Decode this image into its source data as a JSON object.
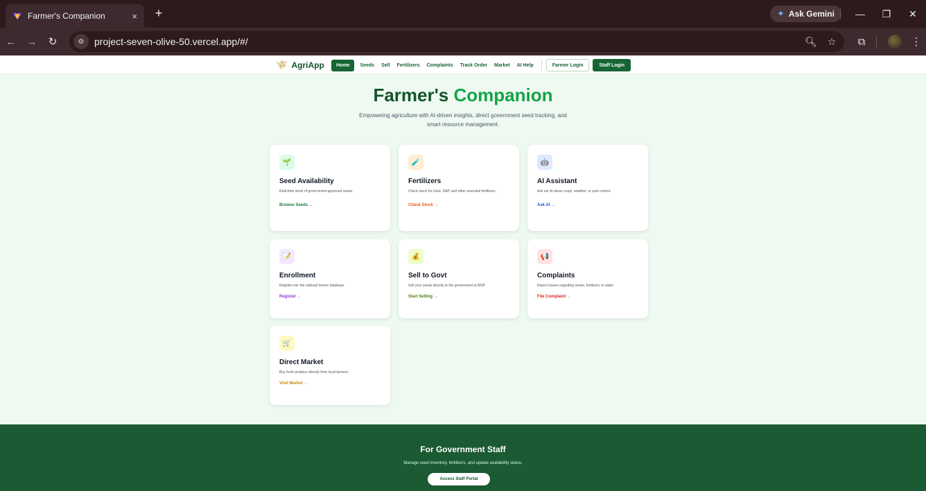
{
  "browser": {
    "tab_title": "Farmer's Companion",
    "tab_close": "×",
    "new_tab": "+",
    "gemini_label": "Ask Gemini",
    "url": "project-seven-olive-50.vercel.app/#/",
    "icons": {
      "favicon": "purple-heart-favicon-icon",
      "back": "arrow-left-icon",
      "forward": "arrow-right-icon",
      "reload": "reload-icon",
      "site_info": "tune-icon",
      "zoom": "zoom-icon",
      "bookmark": "star-icon",
      "extensions": "puzzle-icon",
      "menu": "kebab-icon"
    }
  },
  "nav": {
    "brand": "AgriApp",
    "links": [
      "Home",
      "Seeds",
      "Sell",
      "Fertilizers",
      "Complaints",
      "Track Order",
      "Market",
      "AI Help"
    ],
    "active_link": "Home",
    "farmer_login": "Farmer Login",
    "staff_login": "Staff Login"
  },
  "hero": {
    "title_part1": "Farmer's",
    "title_part2": "Companion",
    "subtitle": "Empowering agriculture with AI-driven insights, direct government seed tracking, and smart resource management."
  },
  "cards": [
    {
      "title": "Seed Availability",
      "desc": "Real-time stock of government-approved seeds.",
      "link": "Browse Seeds →",
      "icon": "🌱",
      "icon_bg": "#dcfce7",
      "link_color": "#15803d"
    },
    {
      "title": "Fertilizers",
      "desc": "Check stock for Urea, DAP, and other essential fertilizers.",
      "link": "Check Stock →",
      "icon": "🧪",
      "icon_bg": "#ffedd5",
      "link_color": "#ea580c"
    },
    {
      "title": "AI Assistant",
      "desc": "Ask our AI about crops, weather, or pest control.",
      "link": "Ask AI →",
      "icon": "🤖",
      "icon_bg": "#dbeafe",
      "link_color": "#1d4ed8"
    },
    {
      "title": "Enrollment",
      "desc": "Register into the national farmer database.",
      "link": "Register →",
      "icon": "📝",
      "icon_bg": "#f3e8ff",
      "link_color": "#9333ea"
    },
    {
      "title": "Sell to Govt",
      "desc": "Sell your seeds directly to the government at MSP.",
      "link": "Start Selling →",
      "icon": "💰",
      "icon_bg": "#ecfccb",
      "link_color": "#4d7c0f"
    },
    {
      "title": "Complaints",
      "desc": "Report issues regarding seeds, fertilizers or water.",
      "link": "File Complaint →",
      "icon": "📢",
      "icon_bg": "#fee2e2",
      "link_color": "#dc2626"
    },
    {
      "title": "Direct Market",
      "desc": "Buy fresh produce directly from local farmers.",
      "link": "Visit Market →",
      "icon": "🛒",
      "icon_bg": "#fef9c3",
      "link_color": "#ca8a04"
    }
  ],
  "staff": {
    "title": "For Government Staff",
    "subtitle": "Manage seed inventory, fertilizers, and update availability status.",
    "button": "Access Staff Portal"
  }
}
